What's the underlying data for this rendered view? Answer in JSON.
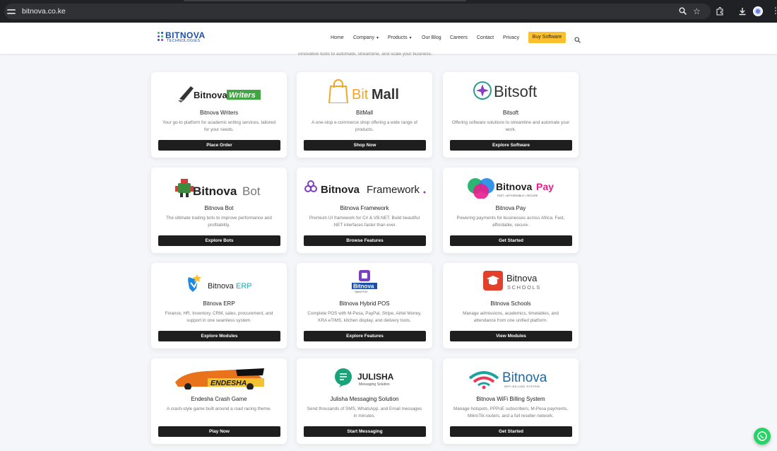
{
  "browser": {
    "url": "bitnova.co.ke"
  },
  "nav": {
    "logo_text": "BITNOVA",
    "logo_sub": "TECHNOLOGIES",
    "links": [
      "Home",
      "Company",
      "Products",
      "Our Blog",
      "Careers",
      "Contact",
      "Privacy"
    ],
    "buy_label": "Buy Software",
    "accent": "#fbc02d"
  },
  "intro": "innovative tools to automate, streamline, and scale your business.",
  "cards": [
    {
      "title": "Bitnova Writers",
      "desc": "Your go-to platform for academic writing services, tailored for your needs.",
      "button": "Place Order",
      "logo": {
        "a": "Bitnova",
        "b": "Writers"
      }
    },
    {
      "title": "BitMall",
      "desc": "A one-stop e-commerce shop offering a wide range of products.",
      "button": "Shop Now",
      "logo": {
        "a": "Bit",
        "b": "Mall"
      }
    },
    {
      "title": "Bitsoft",
      "desc": "Offering software solutions to streamline and automate your work.",
      "button": "Explore Software",
      "logo": {
        "a": "Bitsoft"
      }
    },
    {
      "title": "Bitnova Bot",
      "desc": "The ultimate trading bots to improve performance and profitability.",
      "button": "Explore Bots",
      "logo": {
        "a": "Bitnova",
        "b": "Bot"
      }
    },
    {
      "title": "Bitnova Framework",
      "desc": "Premium UI framework for C# & VB.NET. Build beautiful .NET interfaces faster than ever.",
      "button": "Browse Features",
      "logo": {
        "a": "Bitnova",
        "b": "Framework"
      }
    },
    {
      "title": "Bitnova Pay",
      "desc": "Powering payments for businesses across Africa. Fast, affordable, secure.",
      "button": "Get Started",
      "logo": {
        "a": "Bitnova",
        "b": "Pay",
        "tag": "FAST • AFFORDABLE • SECURE"
      }
    },
    {
      "title": "Bitnova ERP",
      "desc": "Finance, HR, Inventory, CRM, sales, procurement, and support in one seamless system.",
      "button": "Explore Modules",
      "logo": {
        "a": "Bitnova",
        "b": "ERP"
      }
    },
    {
      "title": "Bitnova Hybrid POS",
      "desc": "Complete POS with M-Pesa, PayPal, Stripe, Airtel Money, KRA eTIMS, kitchen display, and delivery tools.",
      "button": "Explore Features",
      "logo": {
        "a": "Bitnova",
        "tag": "Hybrid POS"
      }
    },
    {
      "title": "Bitnova Schools",
      "desc": "Manage admissions, academics, timetables, and attendance from one unified platform.",
      "button": "View Modules",
      "logo": {
        "a": "Bitnova",
        "b": "SCHOOLS"
      }
    },
    {
      "title": "Endesha Crash Game",
      "desc": "A crash-style game built around a road racing theme.",
      "button": "Play Now",
      "logo": {
        "a": "ENDESHA"
      }
    },
    {
      "title": "Julisha Messaging Solution",
      "desc": "Send thousands of SMS, WhatsApp, and Email messages in minutes.",
      "button": "Start Messaging",
      "logo": {
        "a": "JULISHA",
        "b": "Messaging Solution"
      }
    },
    {
      "title": "Bitnova WiFi Billing System",
      "desc": "Manage hotspots, PPPoE subscribers, M-Pesa payments, MikroTik routers, and a full reseller network.",
      "button": "Get Started",
      "logo": {
        "a": "Bitnova",
        "b": "WIFI BILLING SYSTEM"
      }
    }
  ]
}
